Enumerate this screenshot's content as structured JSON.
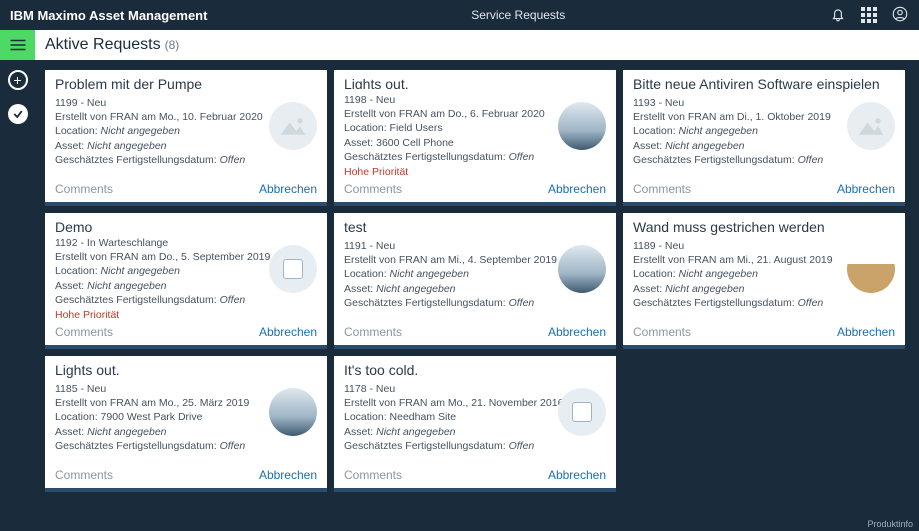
{
  "topbar": {
    "app_title": "IBM Maximo Asset Management",
    "page_title": "Service Requests"
  },
  "heading": {
    "text": "Aktive Requests",
    "count": "(8)"
  },
  "labels": {
    "location": "Location:",
    "asset": "Asset:",
    "estdate": "Geschätztes Fertigstellungsdatum:",
    "comments": "Comments",
    "cancel": "Abbrechen",
    "not_specified": "Nicht angegeben",
    "open": "Offen",
    "high_priority": "Hohe Priorität"
  },
  "cards": [
    {
      "title": "Problem mit der Pumpe",
      "id_status": "1199 - Neu",
      "created": "Erstellt von FRAN am Mo., 10. Februar 2020",
      "location": "Nicht angegeben",
      "asset": "Nicht angegeben",
      "estdate": "Offen",
      "priority": "",
      "thumb": "placeholder"
    },
    {
      "title": "Lights out.",
      "id_status": "1198 - Neu",
      "created": "Erstellt von FRAN am Do., 6. Februar 2020",
      "location": "Field Users",
      "asset": "3600 Cell Phone",
      "estdate": "Offen",
      "priority": "Hohe Priorität",
      "thumb": "office"
    },
    {
      "title": "Bitte neue Antiviren Software einspielen",
      "id_status": "1193 - Neu",
      "created": "Erstellt von FRAN am Di., 1. Oktober 2019",
      "location": "Nicht angegeben",
      "asset": "Nicht angegeben",
      "estdate": "Offen",
      "priority": "",
      "thumb": "placeholder"
    },
    {
      "title": "Demo",
      "id_status": "1192 - In Warteschlange",
      "created": "Erstellt von FRAN am Do., 5. September 2019",
      "location": "Nicht angegeben",
      "asset": "Nicht angegeben",
      "estdate": "Offen",
      "priority": "Hohe Priorität",
      "thumb": "therm"
    },
    {
      "title": "test",
      "id_status": "1191 - Neu",
      "created": "Erstellt von FRAN am Mi., 4. September 2019",
      "location": "Nicht angegeben",
      "asset": "Nicht angegeben",
      "estdate": "Offen",
      "priority": "",
      "thumb": "office"
    },
    {
      "title": "Wand muss gestrichen werden",
      "id_status": "1189 - Neu",
      "created": "Erstellt von FRAN am Mi., 21. August 2019",
      "location": "Nicht angegeben",
      "asset": "Nicht angegeben",
      "estdate": "Offen",
      "priority": "",
      "thumb": "wall"
    },
    {
      "title": "Lights out.",
      "id_status": "1185 - Neu",
      "created": "Erstellt von FRAN am Mo., 25. März 2019",
      "location": "7900 West Park Drive",
      "asset": "Nicht angegeben",
      "estdate": "Offen",
      "priority": "",
      "thumb": "office"
    },
    {
      "title": "It's too cold.",
      "id_status": "1178 - Neu",
      "created": "Erstellt von FRAN am Mo., 21. November 2016",
      "location": "Needham Site",
      "asset": "Nicht angegeben",
      "estdate": "Offen",
      "priority": "",
      "thumb": "therm"
    }
  ],
  "footer": {
    "product_info": "Produktinfo"
  }
}
